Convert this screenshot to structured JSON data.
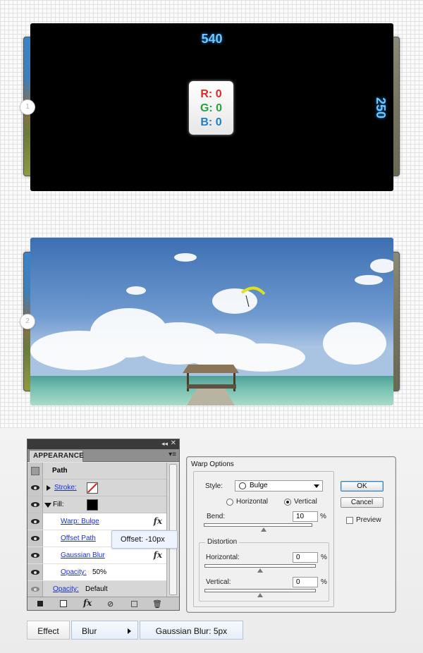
{
  "step1": {
    "badge": "1",
    "width_label": "540",
    "height_label": "250",
    "rgb": {
      "r": "R: 0",
      "g": "G: 0",
      "b": "B: 0"
    }
  },
  "step2": {
    "badge": "2"
  },
  "appearance": {
    "tab": "APPEARANCE",
    "rows": {
      "path": "Path",
      "stroke": "Stroke:",
      "fill": "Fill:",
      "warp": "Warp: Bulge",
      "offset": "Offset Path",
      "blur": "Gaussian Blur",
      "opacity_label": "Opacity:",
      "opacity_value": "50%",
      "opacity2_label": "Opacity:",
      "opacity2_value": "Default"
    },
    "icons": [
      "collapse-icon",
      "close-icon",
      "panel-menu-icon",
      "eye-icon",
      "fx-icon",
      "new-stroke-icon",
      "new-fill-icon",
      "clear-icon",
      "duplicate-icon",
      "delete-icon"
    ]
  },
  "offset_tooltip": "Offset: -10px",
  "warp_options": {
    "title": "Warp Options",
    "style_label": "Style:",
    "style_value": "Bulge",
    "horizontal": "Horizontal",
    "vertical": "Vertical",
    "bend_label": "Bend:",
    "bend_value": "10",
    "bend_unit": "%",
    "distortion_label": "Distortion",
    "dist_h_label": "Horizontal:",
    "dist_h_value": "0",
    "dist_h_unit": "%",
    "dist_v_label": "Vertical:",
    "dist_v_value": "0",
    "dist_v_unit": "%",
    "ok": "OK",
    "cancel": "Cancel",
    "preview": "Preview",
    "bend_percent": 10,
    "dist_h_percent": 0,
    "dist_v_percent": 0
  },
  "breadcrumb": {
    "effect": "Effect",
    "blur": "Blur",
    "gaussian": "Gaussian Blur: 5px"
  },
  "colors": {
    "dimension_label": "#6fc7ff",
    "rgb_r": "#e3262a",
    "rgb_g": "#2aa23a",
    "rgb_b": "#1e7ec8",
    "link": "#1a2ed6"
  }
}
